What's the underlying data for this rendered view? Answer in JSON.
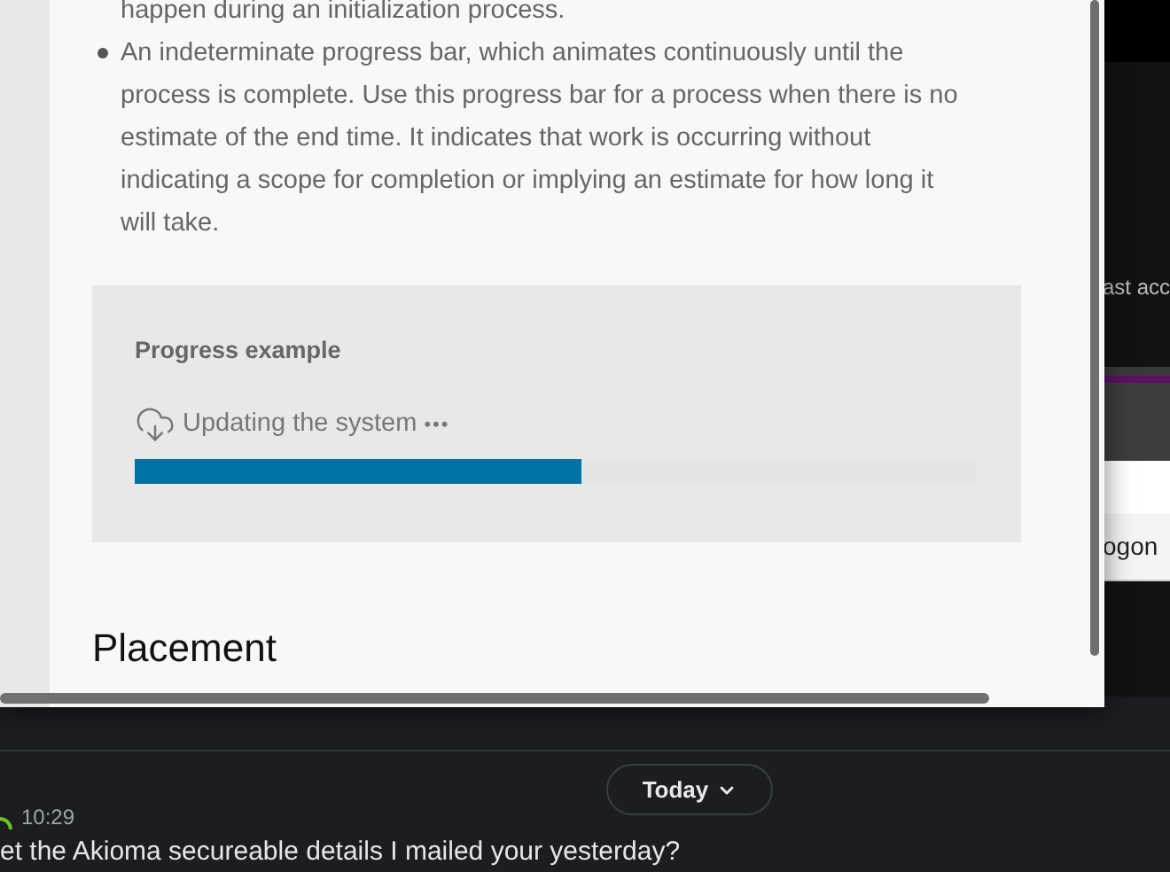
{
  "document": {
    "list_items": [
      {
        "text": "happen during an initialization process.",
        "continued": true
      },
      {
        "text": "An indeterminate progress bar, which animates continuously until the process is complete. Use this progress bar for a process when there is no estimate of the end time. It indicates that work is occurring without indicating a scope for completion or implying an estimate for how long it will take.",
        "continued": false
      }
    ],
    "progress_example": {
      "title": "Progress example",
      "label": "Updating the system",
      "dots": "•••",
      "level": 0.53
    },
    "heading": "Placement"
  },
  "background_app": {
    "side_texts": [
      "ast acc",
      "ogon"
    ],
    "chat": {
      "date_button": "Today",
      "message": {
        "time": "10:29",
        "text": "et the Akioma secureable details I mailed your yesterday?"
      }
    }
  }
}
